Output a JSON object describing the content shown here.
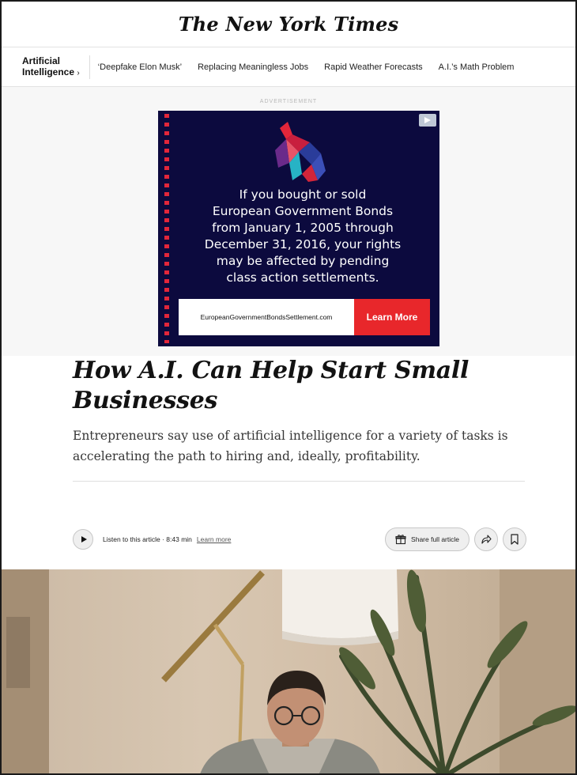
{
  "masthead": {
    "logo": "The New York Times"
  },
  "subnav": {
    "section_line1": "Artificial",
    "section_line2": "Intelligence",
    "section_chevron": "›",
    "items": [
      "‘Deepfake Elon Musk’",
      "Replacing Meaningless Jobs",
      "Rapid Weather Forecasts",
      "A.I.’s Math Problem"
    ]
  },
  "ad": {
    "label": "ADVERTISEMENT",
    "copy": "If you bought or sold\nEuropean Government Bonds\nfrom  January 1, 2005 through\nDecember 31, 2016, your rights\nmay be affected by pending\nclass action settlements.",
    "url_text": "EuropeanGovernmentBondsSettlement.com",
    "cta_label": "Learn More",
    "colors": {
      "background": "#0c0a3e",
      "accent": "#e8272b"
    }
  },
  "article": {
    "headline": "How A.I. Can Help Start Small Businesses",
    "summary": "Entrepreneurs say use of artificial intelligence for a variety of tasks is accelerating the path to hiring and, ideally, profitability."
  },
  "toolbar": {
    "listen_text": "Listen to this article · 8:43 min",
    "learn_more": "Learn more",
    "share_label": "Share full article"
  },
  "icons": {
    "play": "play-icon",
    "gift": "gift-icon",
    "share": "share-arrow-icon",
    "bookmark": "bookmark-icon",
    "adchoices": "adchoices-icon"
  }
}
